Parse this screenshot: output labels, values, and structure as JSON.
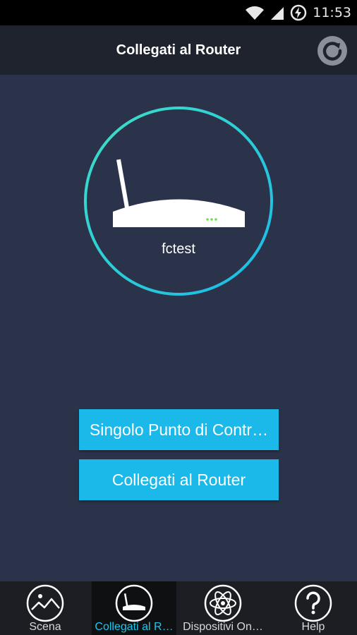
{
  "status_bar": {
    "time": "11:53",
    "icons": [
      "wifi-icon",
      "signal-icon",
      "battery-charging-icon"
    ]
  },
  "header": {
    "title": "Collegati al Router",
    "refresh_icon": "refresh-icon"
  },
  "router": {
    "name": "fctest",
    "icon": "router-icon",
    "ring_color_start": "#3fe0c5",
    "ring_color_end": "#1ab9ea"
  },
  "buttons": {
    "single_control_label": "Singolo Punto di Contr…",
    "connect_router_label": "Collegati al Router",
    "color": "#1ab9ea"
  },
  "bottom_nav": {
    "items": [
      {
        "label": "Scena",
        "icon": "scene-landscape-icon",
        "active": false
      },
      {
        "label": "Collegati al R…",
        "icon": "router-icon",
        "active": true
      },
      {
        "label": "Dispositivi On…",
        "icon": "atom-icon",
        "active": false
      },
      {
        "label": "Help",
        "icon": "help-icon",
        "active": false
      }
    ],
    "active_color": "#1cc7ee"
  }
}
